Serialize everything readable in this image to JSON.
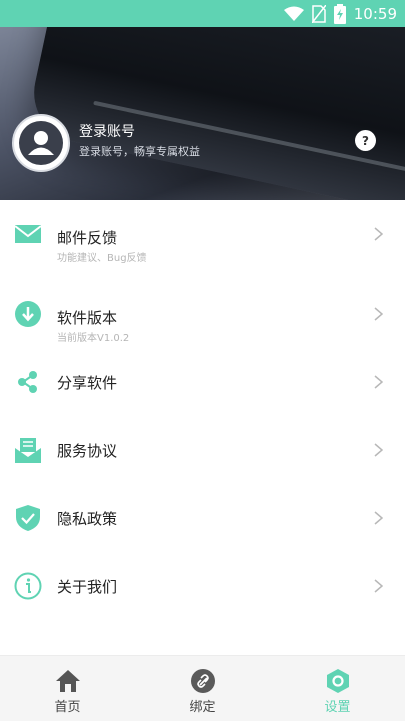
{
  "status_bar": {
    "time": "10:59",
    "icons": [
      "wifi-icon",
      "no-sim-icon",
      "battery-charging-icon"
    ]
  },
  "header": {
    "login_title": "登录账号",
    "login_subtitle": "登录账号，畅享专属权益",
    "help_label": "?"
  },
  "menu": {
    "items": [
      {
        "label": "邮件反馈",
        "sub": "功能建议、Bug反馈",
        "icon": "mail-icon"
      },
      {
        "label": "软件版本",
        "sub": "当前版本V1.0.2",
        "icon": "download-icon"
      },
      {
        "label": "分享软件",
        "sub": "",
        "icon": "share-icon"
      },
      {
        "label": "服务协议",
        "sub": "",
        "icon": "document-icon"
      },
      {
        "label": "隐私政策",
        "sub": "",
        "icon": "shield-icon"
      },
      {
        "label": "关于我们",
        "sub": "",
        "icon": "info-icon"
      }
    ]
  },
  "tabbar": {
    "tabs": [
      {
        "label": "首页",
        "icon": "home-icon",
        "active": false
      },
      {
        "label": "绑定",
        "icon": "link-icon",
        "active": false
      },
      {
        "label": "设置",
        "icon": "settings-icon",
        "active": true
      }
    ]
  },
  "colors": {
    "accent": "#5fd3b3",
    "text_inactive": "#444444",
    "subtext": "#b5b5b5"
  }
}
